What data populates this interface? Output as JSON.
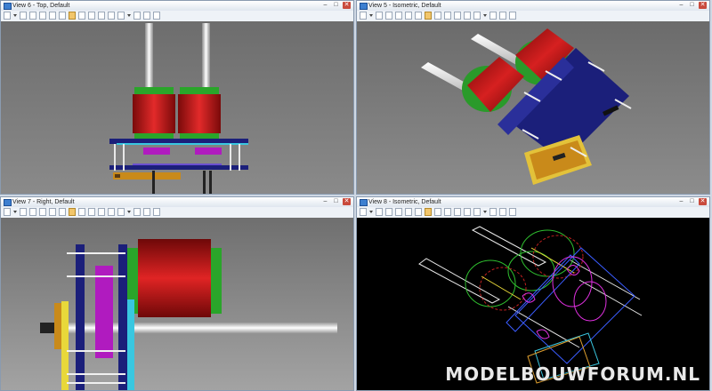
{
  "views": [
    {
      "title": "View 6 - Top, Default"
    },
    {
      "title": "View 5 - Isometric, Default"
    },
    {
      "title": "View 7 - Right, Default"
    },
    {
      "title": "View 8 - Isometric, Default"
    }
  ],
  "window_buttons": {
    "minimize": "–",
    "maximize": "□",
    "close": "✕"
  },
  "watermark": "MODELBOUWFORUM.NL",
  "colors": {
    "motor_red": "#c01818",
    "motor_green": "#2a9a2a",
    "plate_blue": "#1b1f7a",
    "wire_bg": "#000000",
    "viewport_bg_gray": "#7d7d7d"
  }
}
